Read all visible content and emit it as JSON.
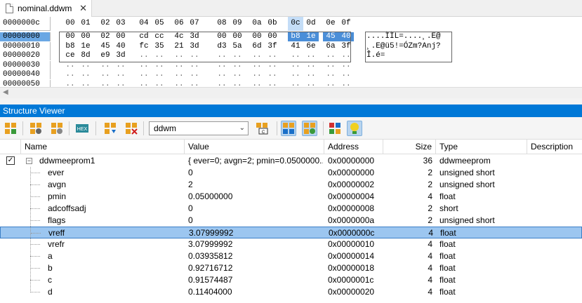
{
  "tab": {
    "label": "nominal.ddwm",
    "close": "✕"
  },
  "hex": {
    "offset_header": "0000000c",
    "columns": [
      "00",
      "01",
      "02",
      "03",
      "04",
      "05",
      "06",
      "07",
      "08",
      "09",
      "0a",
      "0b",
      "0c",
      "0d",
      "0e",
      "0f"
    ],
    "rows": [
      {
        "offset": "00000000",
        "bytes": [
          "00",
          "00",
          "02",
          "00",
          "cd",
          "cc",
          "4c",
          "3d",
          "00",
          "00",
          "00",
          "00",
          "b8",
          "1e",
          "45",
          "40"
        ],
        "ascii": "....ÌÌL=....¸.E@"
      },
      {
        "offset": "00000010",
        "bytes": [
          "b8",
          "1e",
          "45",
          "40",
          "fc",
          "35",
          "21",
          "3d",
          "d3",
          "5a",
          "6d",
          "3f",
          "41",
          "6e",
          "6a",
          "3f"
        ],
        "ascii": "¸.E@ü5!=ÓZm?Anj?"
      },
      {
        "offset": "00000020",
        "bytes": [
          "ce",
          "8d",
          "e9",
          "3d",
          "..",
          "..",
          "..",
          "..",
          "..",
          "..",
          "..",
          "..",
          "..",
          "..",
          "..",
          ".."
        ],
        "ascii": "Î.é="
      },
      {
        "offset": "00000030",
        "bytes": [
          "..",
          "..",
          "..",
          "..",
          "..",
          "..",
          "..",
          "..",
          "..",
          "..",
          "..",
          "..",
          "..",
          "..",
          "..",
          ".."
        ],
        "ascii": ""
      },
      {
        "offset": "00000040",
        "bytes": [
          "..",
          "..",
          "..",
          "..",
          "..",
          "..",
          "..",
          "..",
          "..",
          "..",
          "..",
          "..",
          "..",
          "..",
          "..",
          ".."
        ],
        "ascii": ""
      },
      {
        "offset": "00000050",
        "bytes": [
          "..",
          "..",
          "..",
          "..",
          "..",
          "..",
          "..",
          "..",
          "..",
          "..",
          "..",
          "..",
          "..",
          "..",
          "..",
          ".."
        ],
        "ascii": ""
      }
    ]
  },
  "structure_viewer": {
    "title": "Structure Viewer",
    "combo_value": "ddwm",
    "columns": {
      "name": "Name",
      "value": "Value",
      "address": "Address",
      "size": "Size",
      "type": "Type",
      "description": "Description"
    },
    "rows": [
      {
        "name": "ddwmeeprom1",
        "value": "{ ever=0; avgn=2; pmin=0.0500000...",
        "address": "0x00000000",
        "size": "36",
        "type": "ddwmeeprom",
        "root": true
      },
      {
        "name": "ever",
        "value": "0",
        "address": "0x00000000",
        "size": "2",
        "type": "unsigned short"
      },
      {
        "name": "avgn",
        "value": "2",
        "address": "0x00000002",
        "size": "2",
        "type": "unsigned short"
      },
      {
        "name": "pmin",
        "value": "0.05000000",
        "address": "0x00000004",
        "size": "4",
        "type": "float"
      },
      {
        "name": "adcoffsadj",
        "value": "0",
        "address": "0x00000008",
        "size": "2",
        "type": "short"
      },
      {
        "name": "flags",
        "value": "0",
        "address": "0x0000000a",
        "size": "2",
        "type": "unsigned short"
      },
      {
        "name": "vreff",
        "value": "3.07999992",
        "address": "0x0000000c",
        "size": "4",
        "type": "float",
        "selected": true
      },
      {
        "name": "vrefr",
        "value": "3.07999992",
        "address": "0x00000010",
        "size": "4",
        "type": "float"
      },
      {
        "name": "a",
        "value": "0.03935812",
        "address": "0x00000014",
        "size": "4",
        "type": "float"
      },
      {
        "name": "b",
        "value": "0.92716712",
        "address": "0x00000018",
        "size": "4",
        "type": "float"
      },
      {
        "name": "c",
        "value": "0.91574487",
        "address": "0x0000001c",
        "size": "4",
        "type": "float"
      },
      {
        "name": "d",
        "value": "0.11404000",
        "address": "0x00000020",
        "size": "4",
        "type": "float"
      }
    ]
  },
  "colors": {
    "accent": "#0078d7",
    "selection": "#9cc6f0",
    "hex_selection": "#4a8ed8"
  }
}
